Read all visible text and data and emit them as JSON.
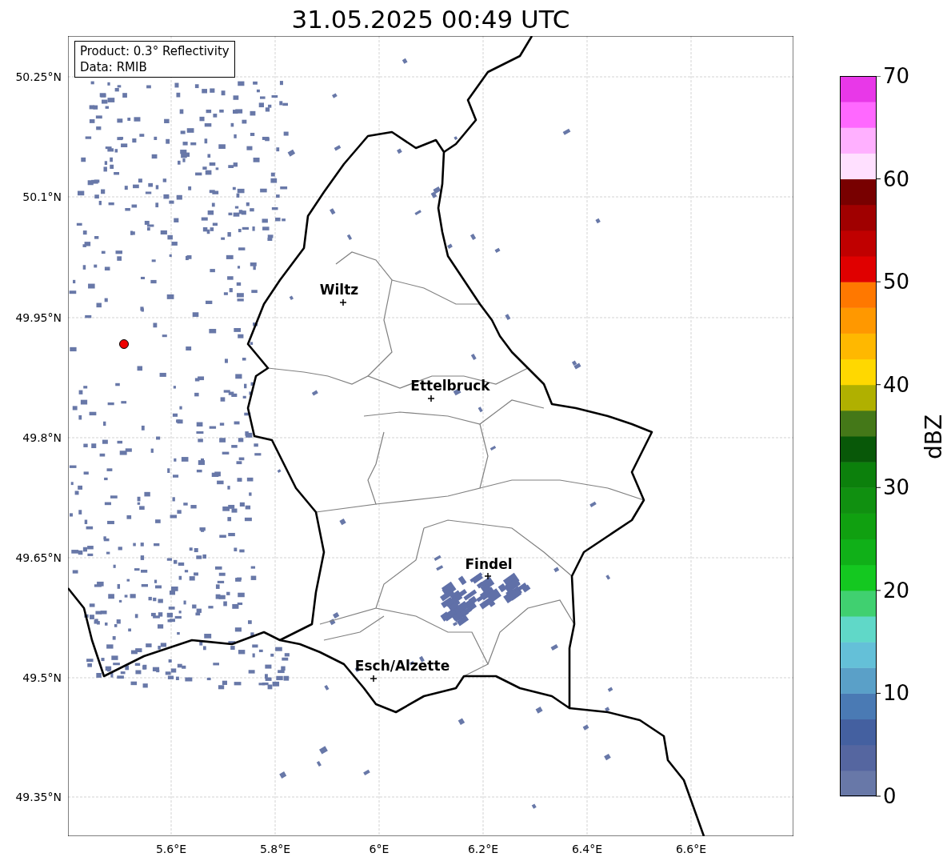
{
  "title": "31.05.2025 00:49 UTC",
  "info_box": {
    "lines": [
      "Product: 0.3° Reflectivity",
      "Data: RMIB"
    ]
  },
  "cities": [
    {
      "name": "Wiltz"
    },
    {
      "name": "Ettelbruck"
    },
    {
      "name": "Findel"
    },
    {
      "name": "Esch/Alzette"
    }
  ],
  "y_ticks": [
    "50.25°N",
    "50.1°N",
    "49.95°N",
    "49.8°N",
    "49.65°N",
    "49.5°N",
    "49.35°N"
  ],
  "x_ticks": [
    "5.6°E",
    "5.8°E",
    "6°E",
    "6.2°E",
    "6.4°E",
    "6.6°E"
  ],
  "colorbar": {
    "label": "dBZ",
    "ticks": [
      "70",
      "60",
      "50",
      "40",
      "30",
      "20",
      "10",
      "0"
    ]
  }
}
